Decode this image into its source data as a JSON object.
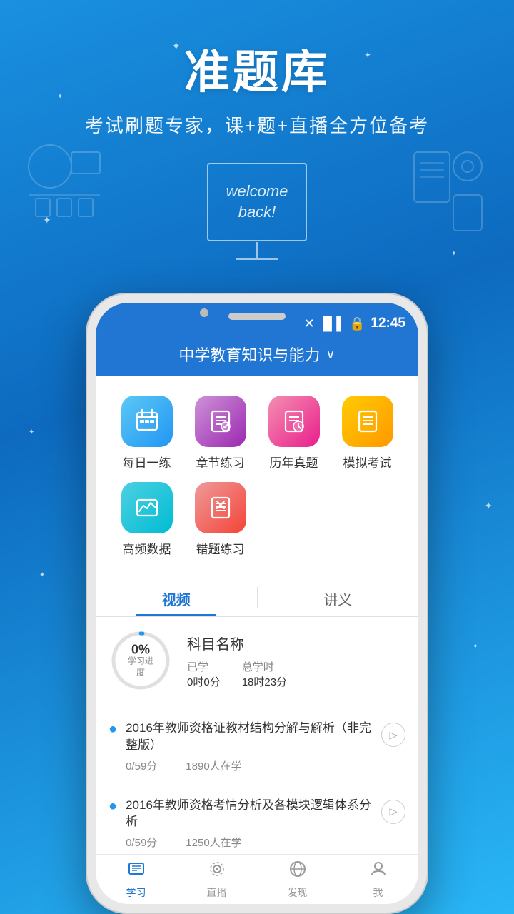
{
  "app": {
    "title": "准题库",
    "subtitle": "考试刷题专家，课+题+直播全方位备考",
    "welcomeText": "welcome back!"
  },
  "statusBar": {
    "time": "12:45",
    "icons": [
      "📶",
      "🔒"
    ]
  },
  "header": {
    "subject": "中学教育知识与能力",
    "chevron": "∨"
  },
  "iconGrid": {
    "row1": [
      {
        "id": "daily",
        "label": "每日一练",
        "colorClass": "ic-blue"
      },
      {
        "id": "chapter",
        "label": "章节练习",
        "colorClass": "ic-purple"
      },
      {
        "id": "history",
        "label": "历年真题",
        "colorClass": "ic-pink"
      },
      {
        "id": "mock",
        "label": "模拟考试",
        "colorClass": "ic-orange"
      }
    ],
    "row2": [
      {
        "id": "highfreq",
        "label": "高频数据",
        "colorClass": "ic-teal"
      },
      {
        "id": "wrong",
        "label": "错题练习",
        "colorClass": "ic-red"
      }
    ]
  },
  "tabs": [
    {
      "id": "video",
      "label": "视频",
      "active": true
    },
    {
      "id": "notes",
      "label": "讲义",
      "active": false
    }
  ],
  "progress": {
    "percent": "0%",
    "label": "学习进度",
    "subjectName": "科目名称",
    "studied": "已学",
    "studiedValue": "0时0分",
    "total": "总学时",
    "totalValue": "18时23分"
  },
  "courses": [
    {
      "title": "2016年教师资格证教材结构分解与解析（非完整版）",
      "score": "0/59分",
      "students": "1890人在学"
    },
    {
      "title": "2016年教师资格考情分析及各模块逻辑体系分析",
      "score": "0/59分",
      "students": "1250人在学"
    }
  ],
  "bottomNav": [
    {
      "id": "study",
      "label": "学习",
      "icon": "📚",
      "active": true
    },
    {
      "id": "live",
      "label": "直播",
      "icon": "📡",
      "active": false
    },
    {
      "id": "discover",
      "label": "发现",
      "icon": "🔍",
      "active": false
    },
    {
      "id": "profile",
      "label": "我",
      "icon": "👤",
      "active": false
    }
  ],
  "colors": {
    "primary": "#2176d4",
    "bgGradientTop": "#1a90e0",
    "bgGradientBottom": "#0d6abf"
  }
}
